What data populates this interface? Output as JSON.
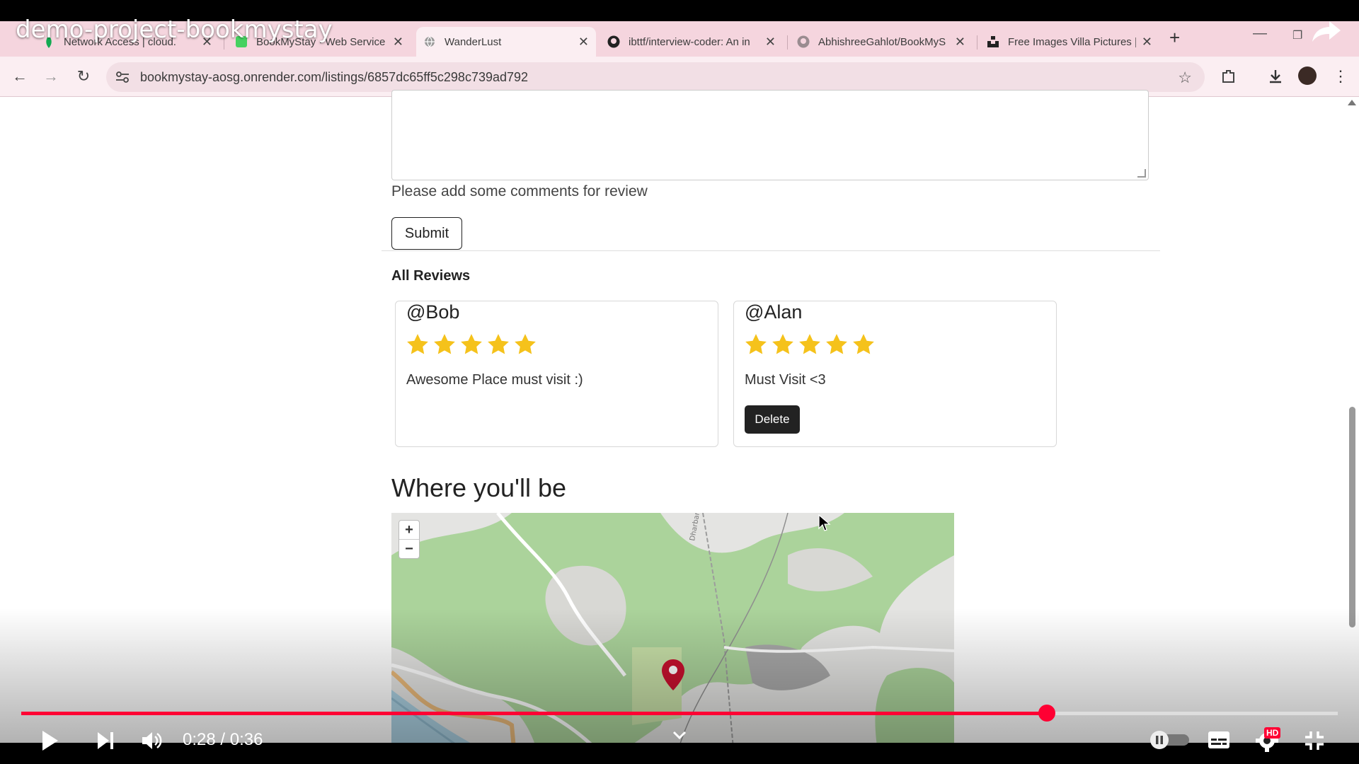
{
  "video": {
    "title": "demo-project-bookmystay",
    "time_current": "0:28",
    "time_separator": " / ",
    "time_total": "0:36",
    "progress": 0.779,
    "hd_badge": "HD"
  },
  "browser": {
    "tabs": [
      {
        "label": "Network Access | cloud.",
        "active": false
      },
      {
        "label": "BookMyStay · Web Service",
        "active": false
      },
      {
        "label": "WanderLust",
        "active": true
      },
      {
        "label": "ibttf/interview-coder: An in",
        "active": false
      },
      {
        "label": "AbhishreeGahlot/BookMyS",
        "active": false
      },
      {
        "label": "Free Images Villa Pictures |",
        "active": false
      }
    ],
    "url": "bookmystay-aosg.onrender.com/listings/6857dc65ff5c298c739ad792"
  },
  "form": {
    "validation_text": "Please add some comments for review",
    "submit_label": "Submit"
  },
  "reviews": {
    "heading": "All Reviews",
    "items": [
      {
        "author": "@Bob",
        "rating": 5,
        "max_rating": 5,
        "comment": "Awesome Place must visit :)",
        "has_delete": false
      },
      {
        "author": "@Alan",
        "rating": 5,
        "max_rating": 5,
        "comment": "Must Visit <3",
        "has_delete": true,
        "delete_label": "Delete"
      }
    ]
  },
  "map": {
    "heading": "Where you'll be",
    "zoom_in": "+",
    "zoom_out": "−",
    "road_label": "Dharbandora"
  },
  "colors": {
    "accent_red": "#ff0033",
    "star_gold": "#f5c21b",
    "tab_strip": "#f5d5de",
    "marker": "#c8102e"
  }
}
